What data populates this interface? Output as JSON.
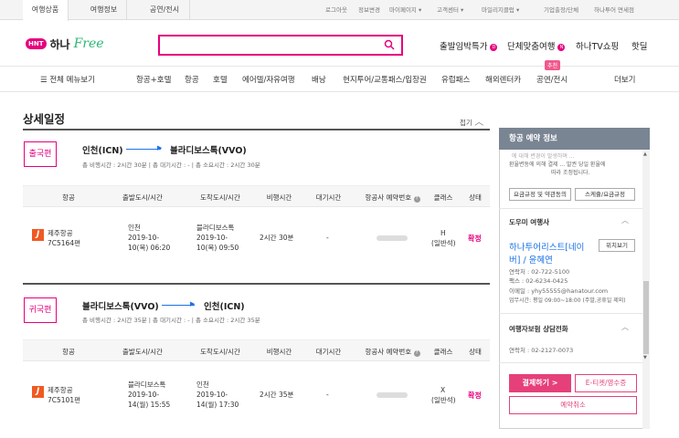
{
  "topbar": {
    "tabs": [
      "여행상품",
      "여행정보",
      "공연/전시"
    ],
    "util": [
      "로그아웃",
      "정보변경",
      "마이페이지 ▾",
      "고객센터 ▾",
      "마일리지클럽 ▾",
      "기업출장/단체",
      "하나투어 면세점"
    ]
  },
  "header": {
    "logo_mark": "HNT",
    "logo_hana": "하나",
    "logo_free": "Free",
    "search_placeholder": "",
    "links": [
      {
        "label": "출발임박특가",
        "badge": "D"
      },
      {
        "label": "단체맞춤여행",
        "badge": "N"
      },
      {
        "label": "하나TV쇼핑"
      },
      {
        "label": "핫딜"
      }
    ]
  },
  "gnb": {
    "menu_all": "☰ 전체 메뉴보기",
    "items": [
      "항공+호텔",
      "항공",
      "호텔",
      "에어텔/자유여행",
      "배낭",
      "현지투어/교통패스/입장권",
      "유럽패스",
      "해외렌터카",
      "공연/전시"
    ],
    "new_badge": "추천",
    "more": "더보기"
  },
  "main": {
    "title": "상세일정",
    "fold": "접기",
    "columns": [
      "항공",
      "출발도시/시간",
      "도착도시/시간",
      "비행시간",
      "대기시간",
      "항공사 예약번호",
      "클래스",
      "상태"
    ],
    "legs": [
      {
        "badge": "출국편",
        "from": "인천(ICN)",
        "to": "블라디보스톡(VVO)",
        "summary": "총 비행시간 : 2시간 30분  |  총 대기시간 : -  |  총 소요시간 : 2시간 30분",
        "airline": "제주항공",
        "flight": "7C5164편",
        "dep_city": "인천",
        "dep_date": "2019-10-",
        "dep_time": "10(목) 06:20",
        "arr_city": "블라디보스톡",
        "arr_date": "2019-10-",
        "arr_time": "10(목) 09:50",
        "duration": "2시간 30분",
        "wait": "-",
        "class_code": "H",
        "class_name": "(일반석)",
        "status": "확정"
      },
      {
        "badge": "귀국편",
        "from": "블라디보스톡(VVO)",
        "to": "인천(ICN)",
        "summary": "총 비행시간 : 2시간 35분  |  총 대기시간 : -  |  총 소요시간 : 2시간 35분",
        "airline": "제주항공",
        "flight": "7C5101편",
        "dep_city": "블라디보스톡",
        "dep_date": "2019-10-",
        "dep_time": "14(월) 15:55",
        "arr_city": "인천",
        "arr_date": "2019-10-",
        "arr_time": "14(월) 17:30",
        "duration": "2시간 35분",
        "wait": "-",
        "class_code": "X",
        "class_name": "(일반석)",
        "status": "확정"
      }
    ]
  },
  "side": {
    "title": "항공 예약 정보",
    "notice1": "에 대해 변경이 발생하며 ...",
    "notice2": "환율변동에 의해 결제 ... 발권 당일 환율에",
    "notice3": "따라 조정됩니다.",
    "btn_rules": "요금규정 및 약관동의",
    "btn_schedule": "스케쥴/요금규정",
    "agency_head": "도우미 여행사",
    "agency_name1": "하나투어리스트[네이",
    "agency_name2": "버] / 윤혜연",
    "map_btn": "위치보기",
    "contact": "연락처 : 02-722-5100",
    "fax": "팩스 : 02-6234-0425",
    "email": "이메일 : yhy55555@hanatour.com",
    "hours": "업무시간: 평일 09:00~18:00 (주말,공휴일 제외)",
    "insurance_head": "여행자보험 상담전화",
    "insurance_contact": "연락처 : 02-2127-0073",
    "pay_btn": "결제하기  >",
    "ticket_btn": "E-티켓/영수증",
    "cancel_btn": "예약취소"
  }
}
